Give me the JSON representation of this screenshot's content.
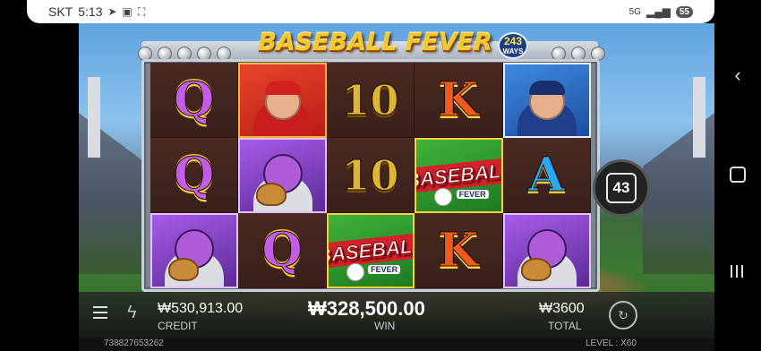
{
  "status_bar": {
    "carrier": "SKT",
    "time": "5:13",
    "network": "5G",
    "battery": "55"
  },
  "game": {
    "title": "BASEBALL FEVER",
    "ways_badge": {
      "number": "243",
      "label": "WAYS"
    },
    "ways_counter": "43",
    "reels": [
      [
        {
          "type": "letter",
          "text": "Q"
        },
        {
          "type": "batter"
        },
        {
          "type": "letter",
          "text": "10"
        },
        {
          "type": "letter",
          "text": "K"
        },
        {
          "type": "pitcher"
        }
      ],
      [
        {
          "type": "letter",
          "text": "Q"
        },
        {
          "type": "catcher"
        },
        {
          "type": "letter",
          "text": "10"
        },
        {
          "type": "logo",
          "text": "BASEBALL",
          "sub": "FEVER"
        },
        {
          "type": "letter",
          "text": "A"
        }
      ],
      [
        {
          "type": "catcher"
        },
        {
          "type": "letter",
          "text": "Q"
        },
        {
          "type": "logo",
          "text": "BASEBALL",
          "sub": "FEVER"
        },
        {
          "type": "letter",
          "text": "K"
        },
        {
          "type": "catcher"
        }
      ]
    ]
  },
  "bottom_bar": {
    "credit_value": "₩530,913.00",
    "credit_label": "CREDIT",
    "win_value": "₩328,500.00",
    "win_label": "WIN",
    "total_value": "₩3600",
    "total_label": "TOTAL"
  },
  "footer": {
    "session_id": "738827653262",
    "level": "LEVEL : X60"
  },
  "colors": {
    "gold": "#f3c92f",
    "reel_bg": "#3a1f1a",
    "frame": "#c9d0d8"
  }
}
